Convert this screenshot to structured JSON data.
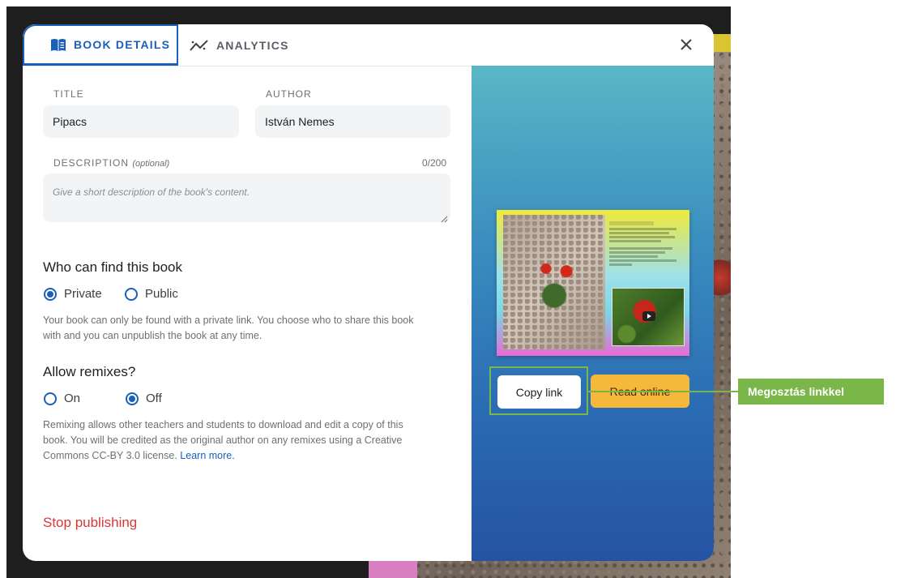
{
  "tabs": [
    {
      "label": "BOOK DETAILS",
      "icon": "book-icon",
      "active": true
    },
    {
      "label": "ANALYTICS",
      "icon": "analytics-icon",
      "active": false
    }
  ],
  "form": {
    "title_label": "TITLE",
    "title_value": "Pipacs",
    "author_label": "AUTHOR",
    "author_value": "István Nemes",
    "description_label": "DESCRIPTION",
    "description_optional": "(optional)",
    "description_counter": "0/200",
    "description_placeholder": "Give a short description of the book's content."
  },
  "visibility": {
    "heading": "Who can find this book",
    "options": [
      {
        "label": "Private",
        "selected": true
      },
      {
        "label": "Public",
        "selected": false
      }
    ],
    "help": "Your book can only be found with a private link. You choose who to share this book with and you can unpublish the book at any time."
  },
  "remixes": {
    "heading": "Allow remixes?",
    "options": [
      {
        "label": "On",
        "selected": false
      },
      {
        "label": "Off",
        "selected": true
      }
    ],
    "help": "Remixing allows other teachers and students to download and edit a copy of this book. You will be credited as the original author on any remixes using a Creative Commons CC-BY 3.0 license.",
    "learn_more": "Learn more."
  },
  "stop_publishing": "Stop publishing",
  "actions": {
    "copy_link": "Copy link",
    "read_online": "Read online"
  },
  "annotation": {
    "label": "Megosztás linkkel",
    "color": "#7ab648"
  },
  "colors": {
    "accent": "#1a5fb8",
    "danger": "#d93636",
    "read_online": "#f5b83a"
  }
}
